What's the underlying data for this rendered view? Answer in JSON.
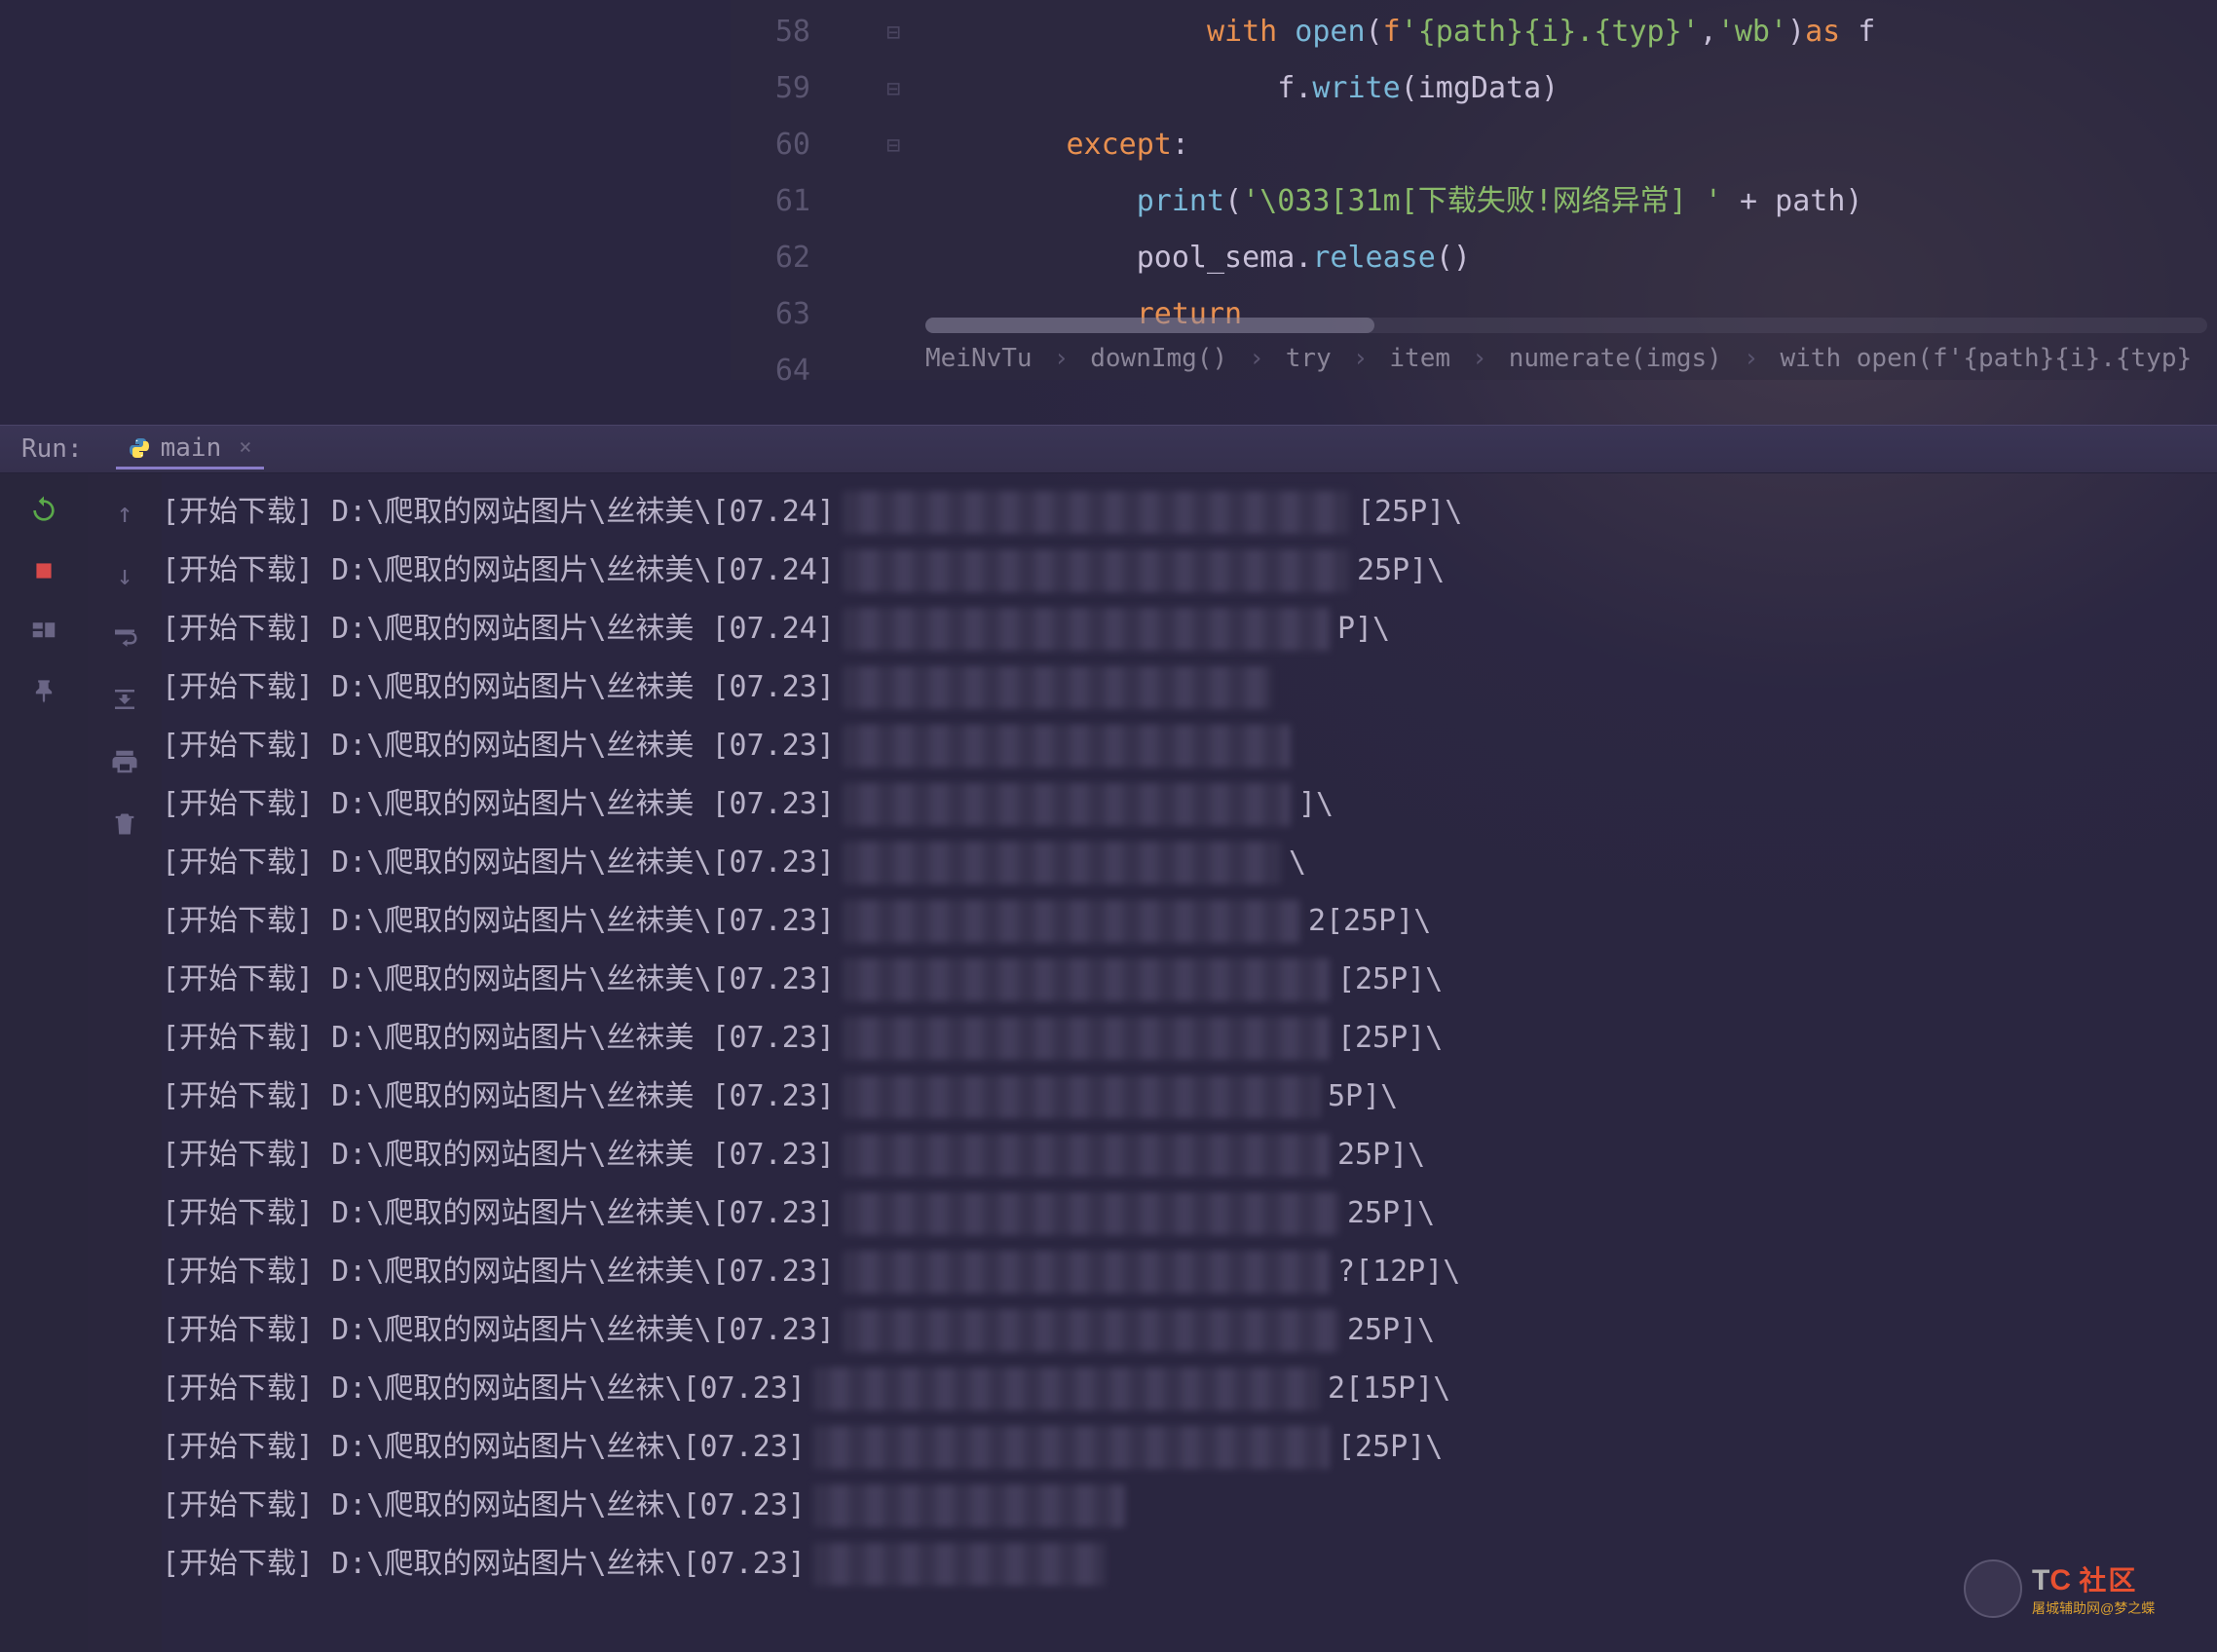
{
  "editor": {
    "gutter": [
      "58",
      "59",
      "60",
      "61",
      "62",
      "63",
      "64"
    ],
    "lines": [
      {
        "indent": 16,
        "tokens": [
          {
            "t": "kw",
            "v": "with"
          },
          {
            "t": "var",
            "v": " "
          },
          {
            "t": "fn",
            "v": "open"
          },
          {
            "t": "var",
            "v": "("
          },
          {
            "t": "kw",
            "v": "f"
          },
          {
            "t": "str",
            "v": "'{path}{i}.{typ}'"
          },
          {
            "t": "var",
            "v": ","
          },
          {
            "t": "str",
            "v": "'wb'"
          },
          {
            "t": "var",
            "v": ")"
          },
          {
            "t": "kw",
            "v": "as"
          },
          {
            "t": "var",
            "v": " f"
          }
        ]
      },
      {
        "indent": 20,
        "tokens": [
          {
            "t": "var",
            "v": "f."
          },
          {
            "t": "fn",
            "v": "write"
          },
          {
            "t": "var",
            "v": "(imgData)"
          }
        ]
      },
      {
        "indent": 8,
        "tokens": [
          {
            "t": "kw",
            "v": "except"
          },
          {
            "t": "var",
            "v": ":"
          }
        ]
      },
      {
        "indent": 12,
        "tokens": [
          {
            "t": "fn",
            "v": "print"
          },
          {
            "t": "var",
            "v": "("
          },
          {
            "t": "str",
            "v": "'\\033[31m[下载失败!网络异常] '"
          },
          {
            "t": "var",
            "v": " + path)"
          }
        ]
      },
      {
        "indent": 12,
        "tokens": [
          {
            "t": "var",
            "v": "pool_sema."
          },
          {
            "t": "fn",
            "v": "release"
          },
          {
            "t": "var",
            "v": "()"
          }
        ]
      },
      {
        "indent": 12,
        "tokens": [
          {
            "t": "kw",
            "v": "return"
          }
        ]
      },
      {
        "indent": 0,
        "tokens": []
      }
    ],
    "breadcrumb": [
      "MeiNvTu",
      "downImg()",
      "try",
      "item",
      "numerate(imgs)",
      "with open(f'{path}{i}.{typ}"
    ]
  },
  "run": {
    "label": "Run:",
    "tab_name": "main",
    "close": "×"
  },
  "console_lines": [
    {
      "prefix": "[开始下载] D:\\爬取的网站图片\\丝袜美",
      "mid": "\\[07.24]",
      "blur": 520,
      "suffix": "[25P]\\"
    },
    {
      "prefix": "[开始下载] D:\\爬取的网站图片\\丝袜美",
      "mid": "\\[07.24]",
      "blur": 520,
      "suffix": "25P]\\"
    },
    {
      "prefix": "[开始下载] D:\\爬取的网站图片\\丝袜美",
      "mid": " [07.24]",
      "blur": 500,
      "suffix": "P]\\"
    },
    {
      "prefix": "[开始下载] D:\\爬取的网站图片\\丝袜美",
      "mid": " [07.23]",
      "blur": 440,
      "suffix": ""
    },
    {
      "prefix": "[开始下载] D:\\爬取的网站图片\\丝袜美",
      "mid": " [07.23]",
      "blur": 460,
      "suffix": ""
    },
    {
      "prefix": "[开始下载] D:\\爬取的网站图片\\丝袜美",
      "mid": " [07.23]",
      "blur": 460,
      "suffix": "]\\"
    },
    {
      "prefix": "[开始下载] D:\\爬取的网站图片\\丝袜美",
      "mid": "\\[07.23]",
      "blur": 450,
      "suffix": "\\"
    },
    {
      "prefix": "[开始下载] D:\\爬取的网站图片\\丝袜美",
      "mid": "\\[07.23]",
      "blur": 470,
      "suffix": "2[25P]\\"
    },
    {
      "prefix": "[开始下载] D:\\爬取的网站图片\\丝袜美",
      "mid": "\\[07.23]",
      "blur": 500,
      "suffix": "[25P]\\"
    },
    {
      "prefix": "[开始下载] D:\\爬取的网站图片\\丝袜美",
      "mid": " [07.23]",
      "blur": 500,
      "suffix": "[25P]\\"
    },
    {
      "prefix": "[开始下载] D:\\爬取的网站图片\\丝袜美",
      "mid": " [07.23]",
      "blur": 490,
      "suffix": "5P]\\"
    },
    {
      "prefix": "[开始下载] D:\\爬取的网站图片\\丝袜美",
      "mid": " [07.23]",
      "blur": 500,
      "suffix": "25P]\\"
    },
    {
      "prefix": "[开始下载] D:\\爬取的网站图片\\丝袜美",
      "mid": "\\[07.23]",
      "blur": 510,
      "suffix": "25P]\\"
    },
    {
      "prefix": "[开始下载] D:\\爬取的网站图片\\丝袜美",
      "mid": "\\[07.23]",
      "blur": 500,
      "suffix": "?[12P]\\"
    },
    {
      "prefix": "[开始下载] D:\\爬取的网站图片\\丝袜美",
      "mid": "\\[07.23]",
      "blur": 510,
      "suffix": "25P]\\"
    },
    {
      "prefix": "[开始下载] D:\\爬取的网站图片\\丝袜",
      "mid": "\\[07.23]",
      "blur": 520,
      "suffix": "2[15P]\\"
    },
    {
      "prefix": "[开始下载] D:\\爬取的网站图片\\丝袜",
      "mid": "\\[07.23]",
      "blur": 530,
      "suffix": "[25P]\\"
    },
    {
      "prefix": "[开始下载] D:\\爬取的网站图片\\丝袜",
      "mid": "\\[07.23]",
      "blur": 320,
      "suffix": ""
    },
    {
      "prefix": "[开始下载] D:\\爬取的网站图片\\丝袜",
      "mid": "\\[07.23]",
      "blur": 300,
      "suffix": ""
    }
  ],
  "watermark": {
    "t": "T",
    "c": "C",
    "sub": "社区",
    "url": "屠城辅助网@梦之蝶"
  }
}
